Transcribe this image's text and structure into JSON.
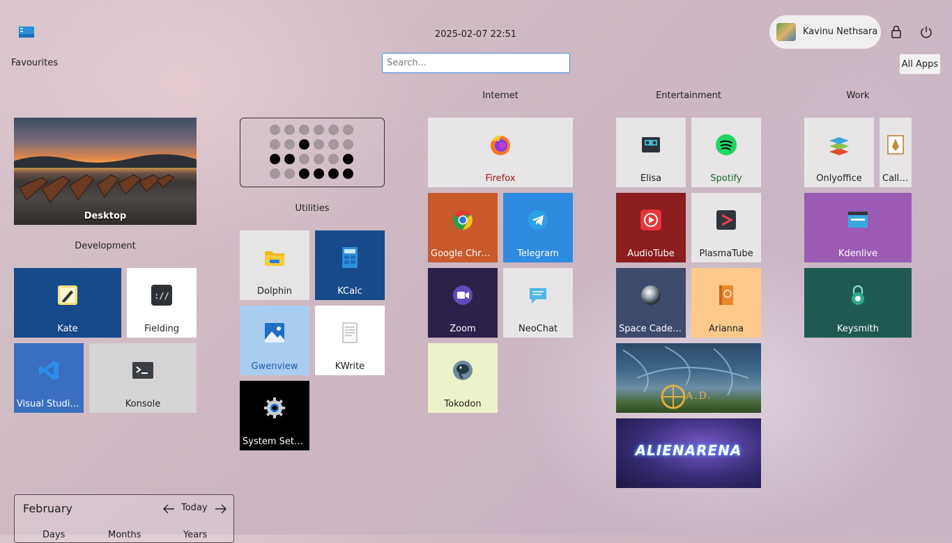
{
  "header": {
    "datetime": "2025-02-07 22:51",
    "user_name": "Kavinu Nethsara",
    "favourites_label": "Favourites",
    "all_apps_label": "All Apps",
    "search_placeholder": "Search..."
  },
  "sections": {
    "development": "Development",
    "utilities": "Utilities",
    "internet": "Internet",
    "entertainment": "Entertainment",
    "work": "Work"
  },
  "tiles": {
    "desktop": "Desktop",
    "kate": "Kate",
    "fielding": "Fielding",
    "vscode": "Visual Studio...",
    "konsole": "Konsole",
    "dolphin": "Dolphin",
    "kcalc": "KCalc",
    "gwenview": "Gwenview",
    "kwrite": "KWrite",
    "system_settings": "System Setti...",
    "firefox": "Firefox",
    "chrome": "Google Chro...",
    "telegram": "Telegram",
    "zoom": "Zoom",
    "neochat": "NeoChat",
    "tokodon": "Tokodon",
    "elisa": "Elisa",
    "spotify": "Spotify",
    "audiotube": "AudioTube",
    "plasmatube": "PlasmaTube",
    "spacecadet": "Space Cadet ...",
    "arianna": "Arianna",
    "zero_ad_logo": "A.D.",
    "alien_arena_logo": "ALIENARENA",
    "onlyoffice": "Onlyoffice",
    "calligra": "Calli...",
    "kdenlive": "Kdenlive",
    "keysmith": "Keysmith"
  },
  "binary_clock": {
    "rows": [
      [
        0,
        0,
        0,
        0,
        0,
        0
      ],
      [
        0,
        0,
        1,
        0,
        0,
        0
      ],
      [
        1,
        1,
        0,
        0,
        0,
        1
      ],
      [
        0,
        0,
        1,
        1,
        1,
        1
      ]
    ]
  },
  "calendar": {
    "month": "February",
    "today_label": "Today",
    "views": [
      "Days",
      "Months",
      "Years"
    ]
  },
  "colors": {
    "accent": "#3d8fd6",
    "firefox_label": "#a01818",
    "spotify_label": "#1b6b2c"
  }
}
